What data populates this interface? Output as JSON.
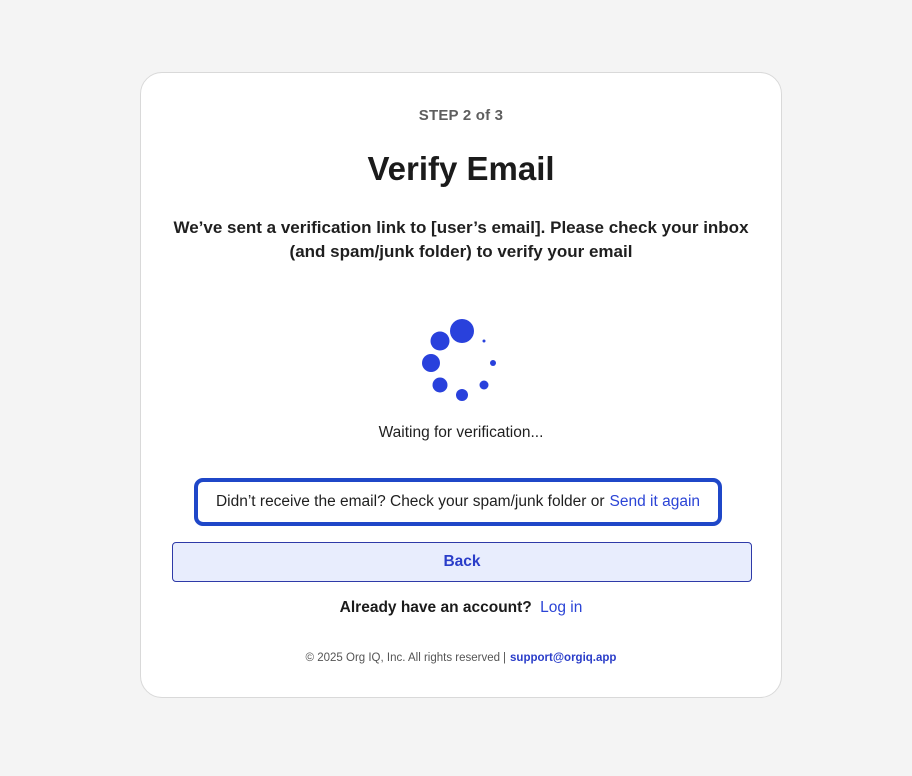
{
  "step_label": "STEP 2 of 3",
  "title": "Verify Email",
  "description": "We’ve sent a verification link to [user’s email]. Please check your inbox (and spam/junk folder) to verify your email",
  "spinner": {
    "icon": "loading-spinner-icon",
    "color": "#2941dc"
  },
  "waiting_text": "Waiting for verification...",
  "resend": {
    "prompt": "Didn’t receive the email? Check your spam/junk folder or",
    "link_label": "Send it again"
  },
  "back_label": "Back",
  "login": {
    "prompt": "Already have an account?",
    "link_label": "Log in"
  },
  "footer": {
    "copyright": "© 2025 Org IQ, Inc. All rights reserved",
    "separator": "|",
    "support_email": "support@orgiq.app"
  },
  "colors": {
    "accent": "#2b44d6",
    "highlight_border": "#1f47c8",
    "button_bg": "#e8edfd",
    "page_bg": "#f4f4f4"
  }
}
